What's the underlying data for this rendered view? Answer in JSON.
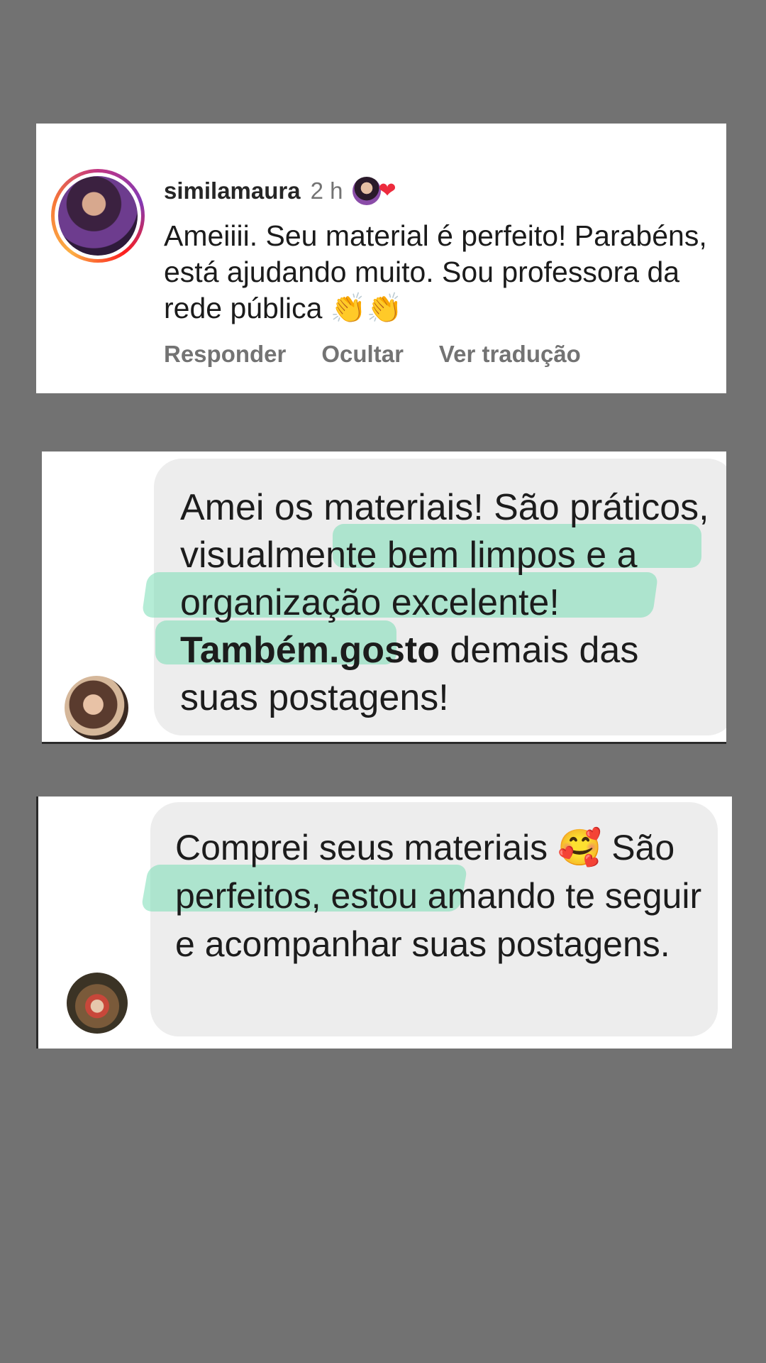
{
  "comment": {
    "username": "similamaura",
    "time": "2 h",
    "text": "Ameiiii. Seu material é perfeito! Parabéns, está ajudando muito. Sou professora da rede pública 👏👏",
    "actions": [
      "Responder",
      "Ocultar",
      "Ver tradução"
    ]
  },
  "messages": [
    {
      "segments": [
        {
          "text": "Amei os materiais! São práticos, visualmente bem limpos e a organização excelente! ",
          "bold": false
        },
        {
          "text": "Também.gosto",
          "bold": true
        },
        {
          "text": " demais das suas postagens!",
          "bold": false
        }
      ]
    },
    {
      "segments": [
        {
          "text": "Comprei seus materiais 🥰 São perfeitos, estou amando te seguir e acompanhar suas postagens.",
          "bold": false
        }
      ]
    }
  ],
  "colors": {
    "background": "#727272",
    "highlight": "#78dcb4",
    "heart": "#ed2b3d",
    "bubble": "#ededed"
  }
}
